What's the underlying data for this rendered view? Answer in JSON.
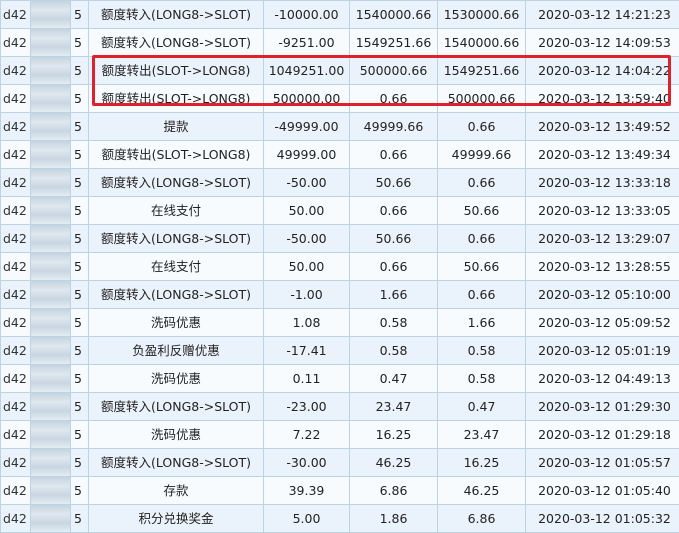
{
  "rows": [
    {
      "id": "d42",
      "level": "5",
      "type": "额度转入(LONG8->SLOT)",
      "amount": "-10000.00",
      "before": "1540000.66",
      "after": "1530000.66",
      "time": "2020-03-12 14:21:23"
    },
    {
      "id": "d42",
      "level": "5",
      "type": "额度转入(LONG8->SLOT)",
      "amount": "-9251.00",
      "before": "1549251.66",
      "after": "1540000.66",
      "time": "2020-03-12 14:09:53"
    },
    {
      "id": "d42",
      "level": "5",
      "type": "额度转出(SLOT->LONG8)",
      "amount": "1049251.00",
      "before": "500000.66",
      "after": "1549251.66",
      "time": "2020-03-12 14:04:22"
    },
    {
      "id": "d42",
      "level": "5",
      "type": "额度转出(SLOT->LONG8)",
      "amount": "500000.00",
      "before": "0.66",
      "after": "500000.66",
      "time": "2020-03-12 13:59:40"
    },
    {
      "id": "d42",
      "level": "5",
      "type": "提款",
      "amount": "-49999.00",
      "before": "49999.66",
      "after": "0.66",
      "time": "2020-03-12 13:49:52"
    },
    {
      "id": "d42",
      "level": "5",
      "type": "额度转出(SLOT->LONG8)",
      "amount": "49999.00",
      "before": "0.66",
      "after": "49999.66",
      "time": "2020-03-12 13:49:34"
    },
    {
      "id": "d42",
      "level": "5",
      "type": "额度转入(LONG8->SLOT)",
      "amount": "-50.00",
      "before": "50.66",
      "after": "0.66",
      "time": "2020-03-12 13:33:18"
    },
    {
      "id": "d42",
      "level": "5",
      "type": "在线支付",
      "amount": "50.00",
      "before": "0.66",
      "after": "50.66",
      "time": "2020-03-12 13:33:05"
    },
    {
      "id": "d42",
      "level": "5",
      "type": "额度转入(LONG8->SLOT)",
      "amount": "-50.00",
      "before": "50.66",
      "after": "0.66",
      "time": "2020-03-12 13:29:07"
    },
    {
      "id": "d42",
      "level": "5",
      "type": "在线支付",
      "amount": "50.00",
      "before": "0.66",
      "after": "50.66",
      "time": "2020-03-12 13:28:55"
    },
    {
      "id": "d42",
      "level": "5",
      "type": "额度转入(LONG8->SLOT)",
      "amount": "-1.00",
      "before": "1.66",
      "after": "0.66",
      "time": "2020-03-12 05:10:00"
    },
    {
      "id": "d42",
      "level": "5",
      "type": "洗码优惠",
      "amount": "1.08",
      "before": "0.58",
      "after": "1.66",
      "time": "2020-03-12 05:09:52"
    },
    {
      "id": "d42",
      "level": "5",
      "type": "负盈利反赠优惠",
      "amount": "-17.41",
      "before": "0.58",
      "after": "0.58",
      "time": "2020-03-12 05:01:19"
    },
    {
      "id": "d42",
      "level": "5",
      "type": "洗码优惠",
      "amount": "0.11",
      "before": "0.47",
      "after": "0.58",
      "time": "2020-03-12 04:49:13"
    },
    {
      "id": "d42",
      "level": "5",
      "type": "额度转入(LONG8->SLOT)",
      "amount": "-23.00",
      "before": "23.47",
      "after": "0.47",
      "time": "2020-03-12 01:29:30"
    },
    {
      "id": "d42",
      "level": "5",
      "type": "洗码优惠",
      "amount": "7.22",
      "before": "16.25",
      "after": "23.47",
      "time": "2020-03-12 01:29:18"
    },
    {
      "id": "d42",
      "level": "5",
      "type": "额度转入(LONG8->SLOT)",
      "amount": "-30.00",
      "before": "46.25",
      "after": "16.25",
      "time": "2020-03-12 01:05:57"
    },
    {
      "id": "d42",
      "level": "5",
      "type": "存款",
      "amount": "39.39",
      "before": "6.86",
      "after": "46.25",
      "time": "2020-03-12 01:05:40"
    },
    {
      "id": "d42",
      "level": "5",
      "type": "积分兑换奖金",
      "amount": "5.00",
      "before": "1.86",
      "after": "6.86",
      "time": "2020-03-12 01:05:32"
    }
  ],
  "highlight": {
    "color": "#e0202a",
    "rows": [
      3,
      4
    ]
  }
}
